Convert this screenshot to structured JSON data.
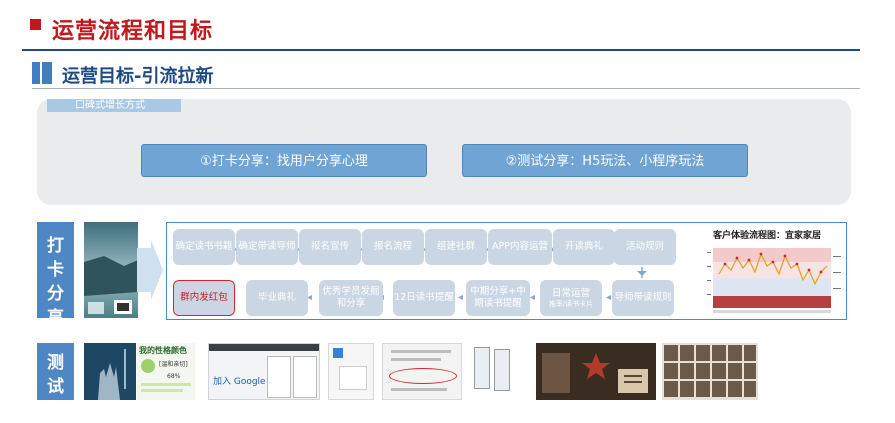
{
  "header": {
    "title": "运营流程和目标",
    "subtitle": "运营目标-引流拉新"
  },
  "panel": {
    "tag": "口碑式增长方式",
    "pill_1": "①打卡分享：找用户分享心理",
    "pill_2": "②测试分享：H5玩法、小程序玩法"
  },
  "checkin": {
    "label": "打卡分享",
    "flow_row1": [
      "确定读书书籍",
      "确定带读导师",
      "报名宣传",
      "报名流程",
      "组建社群",
      "APP内容运营",
      "开读典礼",
      "活动规则"
    ],
    "flow_row2": [
      "群内发红包",
      "毕业典礼",
      "优秀学员发掘和分享",
      "12日读书提醒",
      "中期分享+中期读书提醒",
      "日常运营",
      "导师带读规则"
    ],
    "flow_row2_small": "推率/读书卡片",
    "chart_title": "客户体验流程图：宜家家居"
  },
  "testing": {
    "label": "测试分",
    "thumb_personality_title": "我的性格颜色",
    "thumb_personality_tag": "[温和亲切]",
    "thumb_personality_pct": "68%",
    "thumb_join_google": "加入 Google"
  },
  "colors": {
    "accent_red": "#c0181c",
    "accent_blue": "#1e4b84",
    "pill_blue": "#6fa4d4",
    "node_gray": "#cbd6e4"
  }
}
